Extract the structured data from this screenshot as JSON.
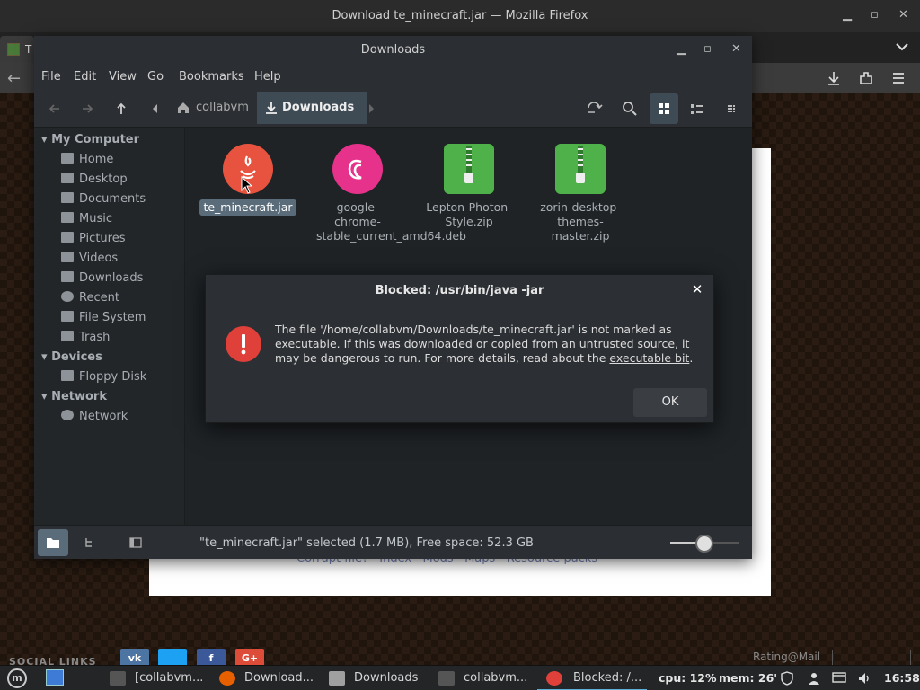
{
  "firefox": {
    "title": "Download te_minecraft.jar — Mozilla Firefox",
    "tab_text": "T"
  },
  "webpage": {
    "links": "Corrupt file? · Index · Mods · Maps · Resource packs",
    "social_title": "SOCIAL LINKS",
    "social": [
      {
        "label": "vk",
        "color": "#4c75a3"
      },
      {
        "label": "",
        "color": "#1da1f2"
      },
      {
        "label": "f",
        "color": "#3b5998"
      },
      {
        "label": "G+",
        "color": "#dd4b39"
      }
    ],
    "rating": "Rating@Mail"
  },
  "nemo": {
    "title": "Downloads",
    "menu": [
      "File",
      "Edit",
      "View",
      "Go",
      "Bookmarks",
      "Help"
    ],
    "breadcrumbs": [
      {
        "label": "collabvm",
        "icon": "home-icon"
      },
      {
        "label": "Downloads",
        "icon": "download-icon"
      }
    ],
    "sidebar": {
      "sections": [
        {
          "title": "My Computer",
          "items": [
            {
              "label": "Home",
              "icon": "home-icon"
            },
            {
              "label": "Desktop",
              "icon": "desktop-icon"
            },
            {
              "label": "Documents",
              "icon": "documents-icon"
            },
            {
              "label": "Music",
              "icon": "music-icon"
            },
            {
              "label": "Pictures",
              "icon": "pictures-icon"
            },
            {
              "label": "Videos",
              "icon": "videos-icon"
            },
            {
              "label": "Downloads",
              "icon": "download-icon"
            },
            {
              "label": "Recent",
              "icon": "recent-icon"
            },
            {
              "label": "File System",
              "icon": "filesystem-icon"
            },
            {
              "label": "Trash",
              "icon": "trash-icon"
            }
          ]
        },
        {
          "title": "Devices",
          "items": [
            {
              "label": "Floppy Disk",
              "icon": "floppy-icon"
            }
          ]
        },
        {
          "title": "Network",
          "items": [
            {
              "label": "Network",
              "icon": "network-icon"
            }
          ]
        }
      ]
    },
    "files": [
      {
        "name": "te_minecraft.jar",
        "icon": "java-icon",
        "color": "#e8533f",
        "selected": true
      },
      {
        "name": "google-chrome-stable_current_amd64.deb",
        "icon": "debian-icon",
        "color": "#e6328a",
        "selected": false
      },
      {
        "name": "Lepton-Photon-Style.zip",
        "icon": "zip-icon",
        "color": "#4fb14a",
        "selected": false
      },
      {
        "name": "zorin-desktop-themes-master.zip",
        "icon": "zip-icon",
        "color": "#4fb14a",
        "selected": false
      }
    ],
    "status": "\"te_minecraft.jar\" selected (1.7 MB), Free space: 52.3 GB",
    "zoom_level": 0.5
  },
  "dialog": {
    "title": "Blocked: /usr/bin/java -jar",
    "message": "The file '/home/collabvm/Downloads/te_minecraft.jar' is not marked as executable.  If this was downloaded or copied from an untrusted source, it may be dangerous to run.  For more details, read about the ",
    "link": "executable bit",
    "message_end": ".",
    "ok": "OK"
  },
  "taskbar": {
    "tasks": [
      {
        "label": "[collabvm...",
        "icon": "terminal-icon",
        "color": "#555"
      },
      {
        "label": "Download...",
        "icon": "firefox-icon",
        "color": "#e66000"
      },
      {
        "label": "Downloads",
        "icon": "folder-icon",
        "color": "#a0a0a0"
      },
      {
        "label": "collabvm...",
        "icon": "terminal-icon",
        "color": "#555"
      },
      {
        "label": "Blocked: /...",
        "icon": "error-icon",
        "color": "#e0403a"
      }
    ],
    "cpu": "cpu: 12%",
    "mem": "mem: 26'",
    "clock": "16:58"
  }
}
